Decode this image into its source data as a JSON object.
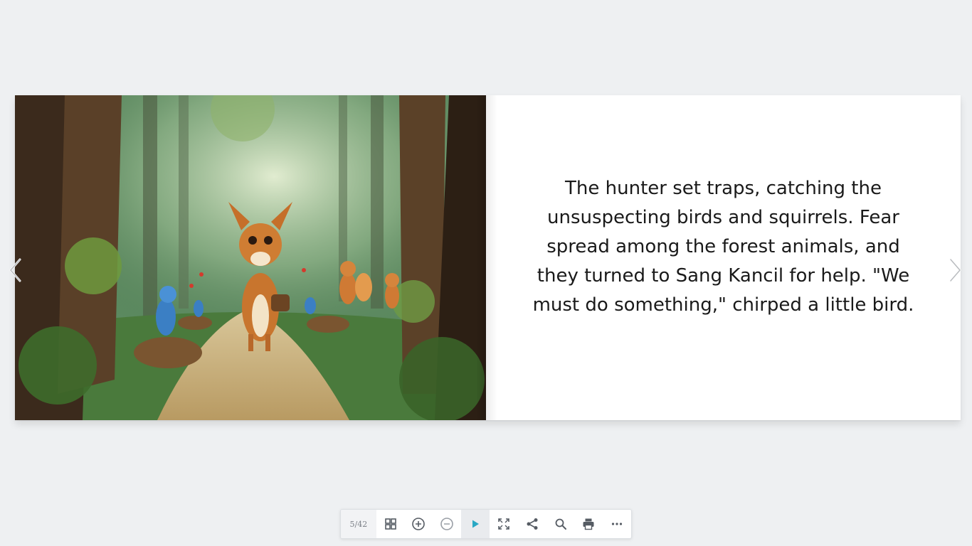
{
  "book": {
    "page_text": "The hunter set traps, catching the unsuspecting birds and squirrels. Fear spread among the forest animals, and they turned to Sang Kancil for help. \"We must do something,\" chirped a little bird.",
    "illustration": "forest-deer-birds-squirrels-illustration"
  },
  "navigation": {
    "prev_icon": "chevron-left-icon",
    "next_icon": "chevron-right-icon"
  },
  "toolbar": {
    "page_counter": "5/42",
    "buttons": [
      {
        "icon": "grid-icon"
      },
      {
        "icon": "zoom-in-icon"
      },
      {
        "icon": "zoom-out-icon"
      },
      {
        "icon": "play-icon"
      },
      {
        "icon": "fullscreen-icon"
      },
      {
        "icon": "share-icon"
      },
      {
        "icon": "search-icon"
      },
      {
        "icon": "print-icon"
      },
      {
        "icon": "more-icon"
      }
    ]
  },
  "colors": {
    "background": "#eef0f2",
    "accent": "#29a8c4",
    "icon": "#555b63"
  }
}
